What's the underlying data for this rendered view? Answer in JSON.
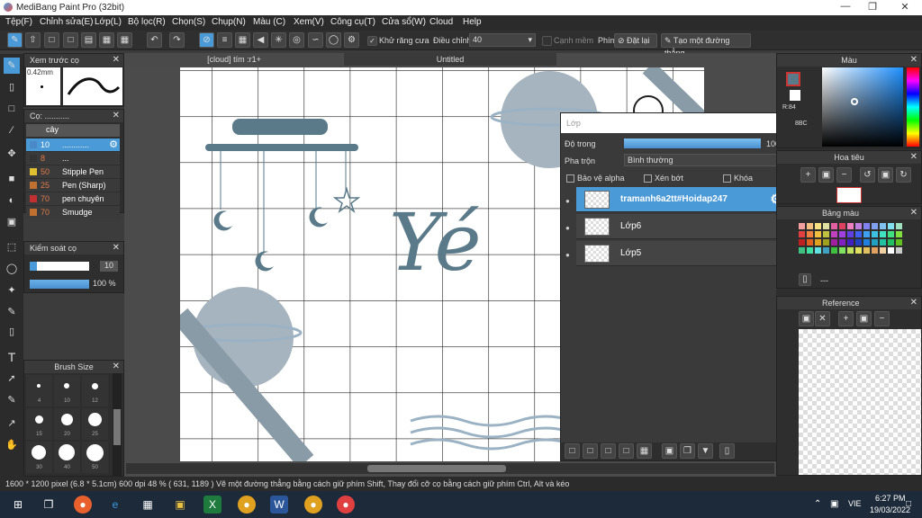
{
  "window": {
    "title": "MediBang Paint Pro (32bit)"
  },
  "menu": [
    "Tệp(F)",
    "Chỉnh sửa(E)",
    "Lớp(L)",
    "Bộ lọc(R)",
    "Chọn(S)",
    "Chụp(N)",
    "Màu (C)",
    "Xem(V)",
    "Công cụ(T)",
    "Cửa sổ(W)",
    "Cloud",
    "Help"
  ],
  "toolbar": {
    "antialias_label": "Khử răng cưa",
    "adjust_label": "Điều chỉnh",
    "adjust_value": "40",
    "edge_label": "Cạnh mềm",
    "key_label": "Phím",
    "reset_label": "Đặt lại",
    "line_label": "Tạo một đường thẳng"
  },
  "brush_preview": {
    "title": "Xem trước cọ",
    "size": "0.42mm"
  },
  "brush_panel": {
    "title": "Cọ: ...........",
    "group": "cây",
    "items": [
      {
        "size": "10",
        "name": "............",
        "color": "#4a88c8"
      },
      {
        "size": "8",
        "name": "...",
        "color": "#333333"
      },
      {
        "size": "50",
        "name": "Stipple Pen",
        "color": "#e0c030"
      },
      {
        "size": "25",
        "name": "Pen (Sharp)",
        "color": "#c07030"
      },
      {
        "size": "70",
        "name": "pen chuyên",
        "color": "#c03030"
      },
      {
        "size": "70",
        "name": "Smudge",
        "color": "#c07030"
      }
    ]
  },
  "brush_control": {
    "title": "Kiểm soát cọ",
    "size": "10",
    "opacity": "100 %"
  },
  "brush_size": {
    "title": "Brush Size",
    "sizes": [
      "4",
      "10",
      "12",
      "15",
      "20",
      "25",
      "30",
      "40",
      "50"
    ]
  },
  "tabs": [
    "[cloud] tím :r1+",
    "Untitled"
  ],
  "canvas": {
    "text": "Yé"
  },
  "layers": {
    "title": "Lớp",
    "opacity_label": "Độ trong",
    "opacity_value": "100 %",
    "blend_label": "Pha trộn",
    "blend_value": "Bình thường",
    "protect_alpha": "Bảo vệ alpha",
    "clip": "Xén bớt",
    "lock": "Khóa",
    "items": [
      "tramanh6a2tt#Hoidap247",
      "Lớp6",
      "Lớp5"
    ]
  },
  "color_panel": {
    "title": "Màu",
    "r_label": "R:84",
    "hex_partial": "8BC"
  },
  "navigator": {
    "title": "Hoa tiêu"
  },
  "palette": {
    "title": "Bảng màu",
    "placeholder": "---"
  },
  "reference": {
    "title": "Reference"
  },
  "status": {
    "text": "1600 * 1200 pixel  (6.8 * 5.1cm)  600 dpi  48 %  ( 631, 1189 )  Vẽ một đường thẳng bằng cách giữ phím Shift, Thay đổi cỡ cọ bằng cách giữ phím Ctrl, Alt và kéo"
  },
  "taskbar": {
    "time": "6:27 PM",
    "date": "19/03/2022",
    "lang": "VIE"
  },
  "colors": {
    "accent": "#4a9ad8",
    "panel": "#2e2e2e",
    "shape": "#8a9ba8",
    "ink": "#5a7a8a"
  }
}
